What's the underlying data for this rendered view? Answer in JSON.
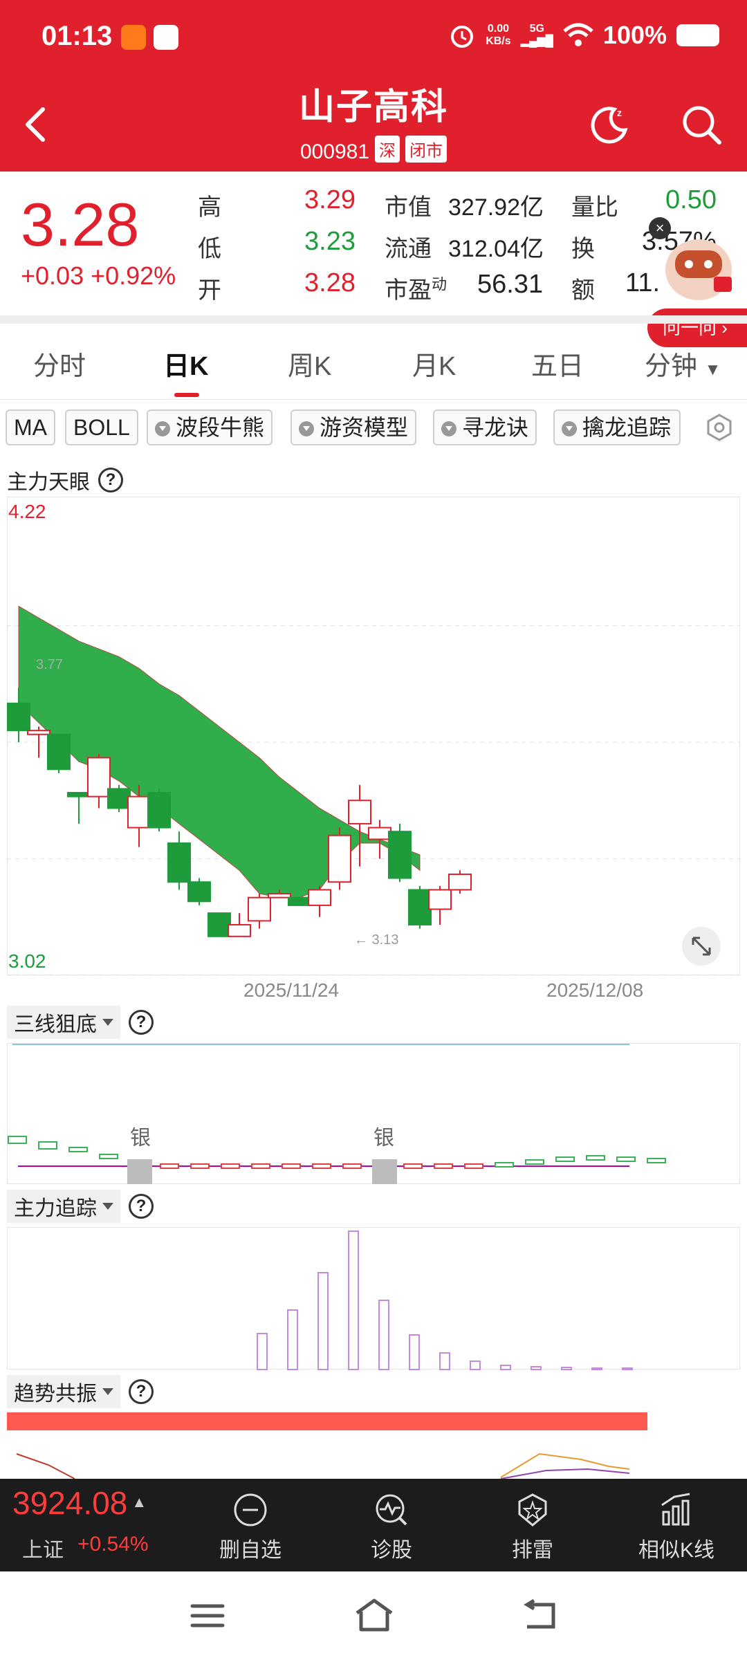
{
  "status_bar": {
    "time": "01:13",
    "net_speed_top": "0.00",
    "net_speed_bottom": "KB/s",
    "signal": "5G",
    "battery": "100%"
  },
  "header": {
    "title": "山子高科",
    "code": "000981",
    "exchange_tag": "深",
    "market_tag": "闭市"
  },
  "quote": {
    "price": "3.28",
    "change": "+0.03 +0.92%",
    "high_label": "高",
    "high": "3.29",
    "low_label": "低",
    "low": "3.23",
    "open_label": "开",
    "open": "3.28",
    "mcap_label": "市值",
    "mcap": "327.92亿",
    "float_label": "流通",
    "float": "312.04亿",
    "pe_label": "市盈",
    "pe_sup": "动",
    "pe": "56.31",
    "volratio_label": "量比",
    "volratio": "0.50",
    "turnover_label": "换",
    "turnover": "3.57%",
    "amount_label": "额",
    "amount": "11.",
    "ask_button": "问一问"
  },
  "tabs": [
    "分时",
    "日K",
    "周K",
    "月K",
    "五日",
    "分钟"
  ],
  "indicators": [
    "MA",
    "BOLL",
    "波段牛熊",
    "游资模型",
    "寻龙诀",
    "擒龙追踪"
  ],
  "main_chart": {
    "label": "主力天眼",
    "y_max": "4.22",
    "y_min": "3.02",
    "hi_marker": "3.77",
    "lo_marker": "← 3.13",
    "dates": [
      "2025/11/24",
      "2025/12/08"
    ]
  },
  "sub1": {
    "label": "三线狙底",
    "signals": [
      "银",
      "银"
    ]
  },
  "sub2": {
    "label": "主力追踪"
  },
  "sub3": {
    "label": "趋势共振"
  },
  "bottom_bar": {
    "index_value": "3924.08",
    "index_name": "上证",
    "index_change": "+0.54%",
    "items": [
      "删自选",
      "诊股",
      "排雷",
      "相似K线"
    ]
  },
  "colors": {
    "brand_red": "#e0212d",
    "up_red": "#e0212d",
    "down_green": "#1e9b3a",
    "band_green": "#2fae4b"
  },
  "chart_data": {
    "type": "candlestick",
    "ylim": [
      3.02,
      4.22
    ],
    "candles": [
      {
        "o": 3.72,
        "h": 3.76,
        "l": 3.62,
        "c": 3.65
      },
      {
        "o": 3.64,
        "h": 3.66,
        "l": 3.58,
        "c": 3.65
      },
      {
        "o": 3.64,
        "h": 3.64,
        "l": 3.54,
        "c": 3.55
      },
      {
        "o": 3.49,
        "h": 3.49,
        "l": 3.41,
        "c": 3.48
      },
      {
        "o": 3.48,
        "h": 3.59,
        "l": 3.45,
        "c": 3.58
      },
      {
        "o": 3.5,
        "h": 3.51,
        "l": 3.44,
        "c": 3.45
      },
      {
        "o": 3.4,
        "h": 3.51,
        "l": 3.35,
        "c": 3.48
      },
      {
        "o": 3.49,
        "h": 3.5,
        "l": 3.39,
        "c": 3.4
      },
      {
        "o": 3.36,
        "h": 3.39,
        "l": 3.24,
        "c": 3.26
      },
      {
        "o": 3.26,
        "h": 3.27,
        "l": 3.2,
        "c": 3.21
      },
      {
        "o": 3.18,
        "h": 3.18,
        "l": 3.12,
        "c": 3.12
      },
      {
        "o": 3.12,
        "h": 3.18,
        "l": 3.12,
        "c": 3.15
      },
      {
        "o": 3.16,
        "h": 3.23,
        "l": 3.14,
        "c": 3.22
      },
      {
        "o": 3.22,
        "h": 3.24,
        "l": 3.22,
        "c": 3.23
      },
      {
        "o": 3.22,
        "h": 3.22,
        "l": 3.2,
        "c": 3.2
      },
      {
        "o": 3.2,
        "h": 3.25,
        "l": 3.17,
        "c": 3.24
      },
      {
        "o": 3.26,
        "h": 3.4,
        "l": 3.24,
        "c": 3.38
      },
      {
        "o": 3.41,
        "h": 3.51,
        "l": 3.3,
        "c": 3.47
      },
      {
        "o": 3.37,
        "h": 3.42,
        "l": 3.32,
        "c": 3.4
      },
      {
        "o": 3.39,
        "h": 3.41,
        "l": 3.26,
        "c": 3.27
      },
      {
        "o": 3.24,
        "h": 3.25,
        "l": 3.14,
        "c": 3.15
      },
      {
        "o": 3.19,
        "h": 3.25,
        "l": 3.15,
        "c": 3.24
      },
      {
        "o": 3.24,
        "h": 3.29,
        "l": 3.23,
        "c": 3.28
      }
    ],
    "band_upper": [
      3.97,
      3.94,
      3.91,
      3.88,
      3.86,
      3.84,
      3.81,
      3.77,
      3.74,
      3.7,
      3.66,
      3.62,
      3.58,
      3.53,
      3.49,
      3.45,
      3.42,
      3.39,
      3.37,
      3.35,
      3.33
    ],
    "band_lower": [
      3.72,
      3.67,
      3.62,
      3.57,
      3.55,
      3.52,
      3.48,
      3.45,
      3.41,
      3.37,
      3.33,
      3.29,
      3.23,
      3.22,
      3.22,
      3.24,
      3.31,
      3.36,
      3.36,
      3.33,
      3.29
    ]
  }
}
